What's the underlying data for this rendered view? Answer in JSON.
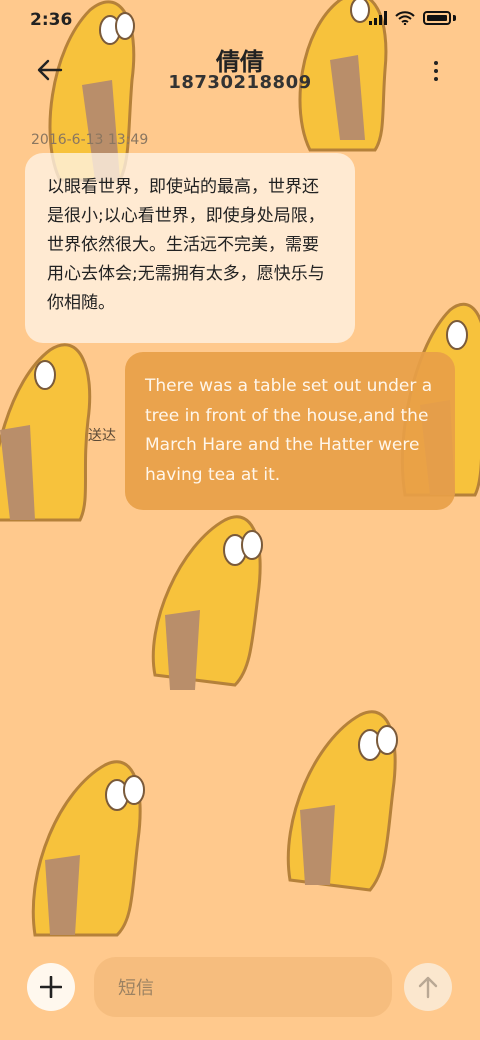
{
  "status_bar": {
    "time": "2:36"
  },
  "header": {
    "contact_name": "倩倩",
    "contact_number": "18730218809"
  },
  "conversation": {
    "timestamp": "2016-6-13 13:49",
    "messages": [
      {
        "direction": "received",
        "text": "以眼看世界，即使站的最高，世界还是很小;以心看世界，即使身处局限，世界依然很大。生活远不完美，需要用心去体会;无需拥有太多，愿快乐与你相随。"
      },
      {
        "direction": "sent",
        "text": "There was a table set out under a tree in front of the house,and the March Hare and the Hatter were having tea at it.",
        "status": "送达"
      }
    ]
  },
  "input_bar": {
    "placeholder": "短信"
  },
  "colors": {
    "background": "#FFC98D",
    "sent_bubble": "#E8A048",
    "received_bubble": "#FFF4E6"
  },
  "icons": [
    "back-arrow-icon",
    "more-vertical-icon",
    "plus-icon",
    "arrow-up-icon",
    "signal-icon",
    "wifi-icon",
    "battery-icon"
  ]
}
